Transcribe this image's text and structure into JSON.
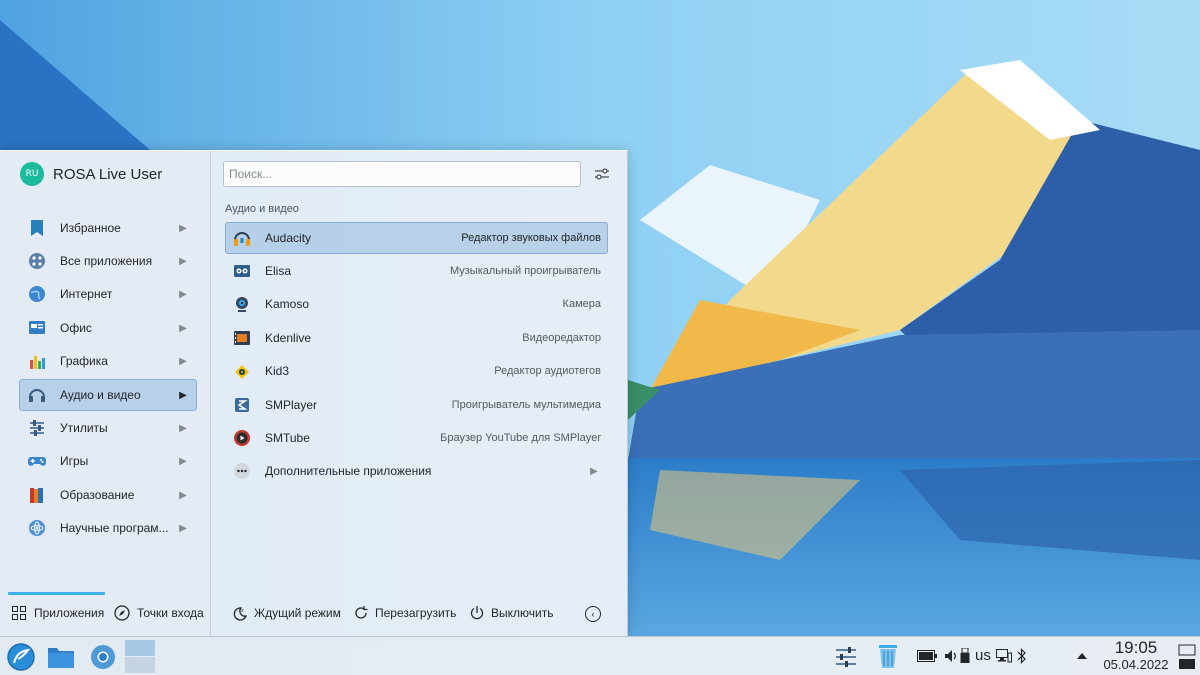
{
  "user": {
    "initials": "RU",
    "name": "ROSA Live User"
  },
  "search": {
    "placeholder": "Поиск..."
  },
  "categories": [
    {
      "label": "Избранное",
      "icon": "bookmark-icon"
    },
    {
      "label": "Все приложения",
      "icon": "all-apps-icon"
    },
    {
      "label": "Интернет",
      "icon": "globe-icon"
    },
    {
      "label": "Офис",
      "icon": "office-icon"
    },
    {
      "label": "Графика",
      "icon": "graphics-icon"
    },
    {
      "label": "Аудио и видео",
      "icon": "headphones-icon",
      "active": true
    },
    {
      "label": "Утилиты",
      "icon": "utilities-icon"
    },
    {
      "label": "Игры",
      "icon": "gamepad-icon"
    },
    {
      "label": "Образование",
      "icon": "books-icon"
    },
    {
      "label": "Научные програм...",
      "icon": "science-icon"
    }
  ],
  "section_heading": "Аудио и видео",
  "apps": [
    {
      "name": "Audacity",
      "desc": "Редактор звуковых файлов",
      "icon": "audacity-icon",
      "active": true
    },
    {
      "name": "Elisa",
      "desc": "Музыкальный проигрыватель",
      "icon": "elisa-icon"
    },
    {
      "name": "Kamoso",
      "desc": "Камера",
      "icon": "webcam-icon"
    },
    {
      "name": "Kdenlive",
      "desc": "Видеоредактор",
      "icon": "kdenlive-icon"
    },
    {
      "name": "Kid3",
      "desc": "Редактор аудиотегов",
      "icon": "kid3-icon"
    },
    {
      "name": "SMPlayer",
      "desc": "Проигрыватель мультимедиа",
      "icon": "smplayer-icon"
    },
    {
      "name": "SMTube",
      "desc": "Браузер YouTube для SMPlayer",
      "icon": "smtube-icon"
    },
    {
      "name": "Дополнительные приложения",
      "desc": "",
      "icon": "more-icon",
      "submenu": true
    }
  ],
  "bottom_tabs": {
    "applications": "Приложения",
    "places": "Точки входа"
  },
  "power": {
    "sleep": "Ждущий режим",
    "restart": "Перезагрузить",
    "shutdown": "Выключить"
  },
  "tray": {
    "keyboard_layout": "us"
  },
  "clock": {
    "time": "19:05",
    "date": "05.04.2022"
  },
  "colors": {
    "accent": "#3daee9",
    "selection": "#93bade",
    "avatar": "#1abc9c"
  }
}
